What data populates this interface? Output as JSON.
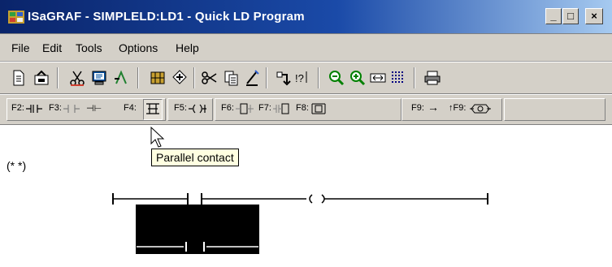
{
  "window": {
    "title": "ISaGRAF - SIMPLELD:LD1 - Quick LD Program",
    "minimize_glyph": "_",
    "maximize_glyph": "□",
    "close_glyph": "×"
  },
  "menu": {
    "items": [
      {
        "label": "File"
      },
      {
        "label": "Edit"
      },
      {
        "label": "Tools"
      },
      {
        "label": "Options"
      },
      {
        "label": "Help"
      }
    ]
  },
  "toolbar": {
    "icons": [
      "file-icon",
      "save-icon",
      "cut-tool-icon",
      "monitor-icon",
      "cross-reference-icon",
      "dictionary-icon",
      "split-icon",
      "cut-icon",
      "copy-icon",
      "paste-icon",
      "jump-icon",
      "find-icon",
      "zoom-out-icon",
      "zoom-in-icon",
      "fit-icon",
      "grid-icon",
      "print-icon"
    ]
  },
  "ld_toolbar": {
    "f2": "F2:",
    "f3": "F3:",
    "f4": "F4:",
    "f5": "F5:",
    "f6": "F6:",
    "f7": "F7:",
    "f8": "F8:",
    "f9": "F9:",
    "f9_arrow": "→",
    "shift_f9": "↑F9:",
    "selected": "F4"
  },
  "editor": {
    "comment": "(* *)",
    "tooltip": "Parallel contact"
  },
  "colors": {
    "title_start": "#0a246a",
    "title_end": "#a6caf0",
    "face": "#d4d0c8",
    "selection": "#000000",
    "tooltip_bg": "#ffffe1"
  }
}
